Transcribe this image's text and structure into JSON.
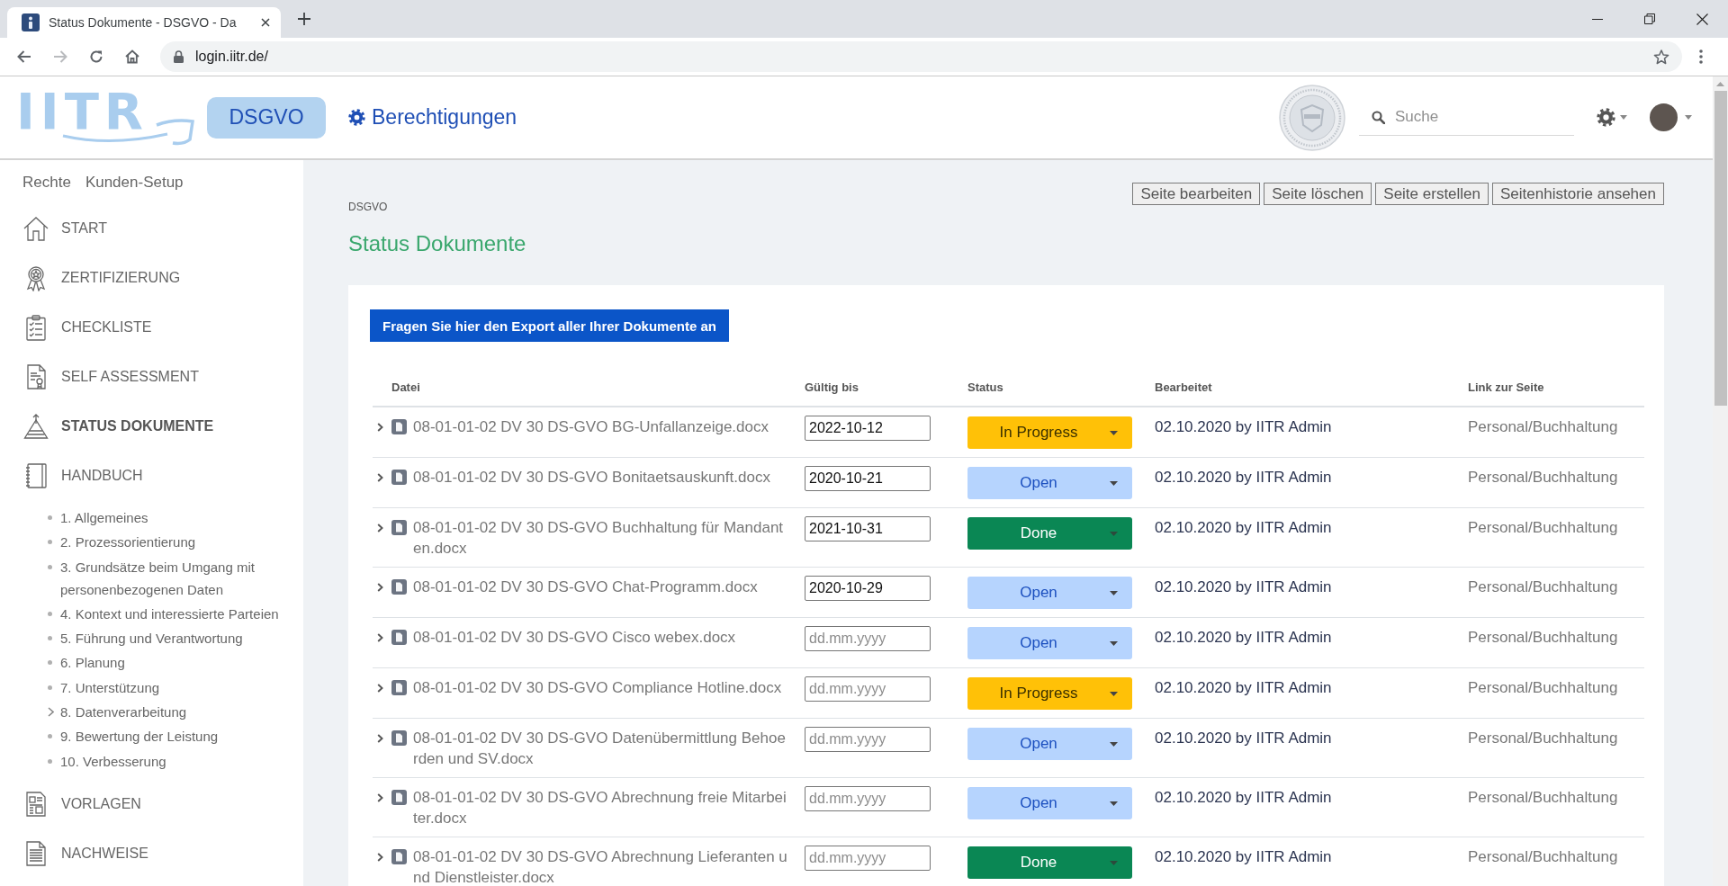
{
  "browser": {
    "tab": {
      "title": "Status Dokumente - DSGVO - Da"
    },
    "forward_disabled": true,
    "url": "login.iitr.de/"
  },
  "header": {
    "logo": "IITR",
    "module_button": "DSGVO",
    "permissions_link": "Berechtigungen",
    "search": {
      "placeholder": "Suche"
    }
  },
  "sidebar": {
    "top_links": [
      "Rechte",
      "Kunden-Setup"
    ],
    "items": [
      {
        "label": "START",
        "selected": false
      },
      {
        "label": "ZERTIFIZIERUNG",
        "selected": false
      },
      {
        "label": "CHECKLISTE",
        "selected": false
      },
      {
        "label": "SELF ASSESSMENT",
        "selected": false
      },
      {
        "label": "STATUS DOKUMENTE",
        "selected": true
      },
      {
        "label": "HANDBUCH",
        "selected": false,
        "children": [
          {
            "label": "1. Allgemeines",
            "expandable": false,
            "selected": false
          },
          {
            "label": "2. Prozessorientierung",
            "expandable": false,
            "selected": false
          },
          {
            "label": "3. Grundsätze beim Umgang mit personenbezogenen Daten",
            "expandable": false,
            "selected": false
          },
          {
            "label": "4. Kontext und interessierte Parteien",
            "expandable": false,
            "selected": false
          },
          {
            "label": "5. Führung und Verantwortung",
            "expandable": false,
            "selected": false
          },
          {
            "label": "6. Planung",
            "expandable": false,
            "selected": false
          },
          {
            "label": "7. Unterstützung",
            "expandable": false,
            "selected": false
          },
          {
            "label": "8. Datenverarbeitung",
            "expandable": true,
            "selected": false
          },
          {
            "label": "9. Bewertung der Leistung",
            "expandable": false,
            "selected": false
          },
          {
            "label": "10. Verbesserung",
            "expandable": false,
            "selected": false
          }
        ]
      },
      {
        "label": "VORLAGEN",
        "selected": false
      },
      {
        "label": "NACHWEISE",
        "selected": false
      }
    ]
  },
  "main": {
    "breadcrumb": "DSGVO",
    "page_actions": [
      "Seite bearbeiten",
      "Seite löschen",
      "Seite erstellen",
      "Seitenhistorie ansehen"
    ],
    "title": "Status Dokumente",
    "export_button": "Fragen Sie hier den Export aller Ihrer Dokumente an",
    "table": {
      "columns": [
        "Datei",
        "Gültig bis",
        "Status",
        "Bearbeitet",
        "Link zur Seite"
      ],
      "rows": [
        {
          "file": "08-01-01-02 DV 30 DS-GVO BG-Unfallanzeige.docx",
          "valid_until": {
            "value": "2022-10-12"
          },
          "status": {
            "label": "In Progress",
            "kind": "progress"
          },
          "edited": "02.10.2020 by IITR Admin",
          "link": "Personal/Buchhaltung"
        },
        {
          "file": "08-01-01-02 DV 30 DS-GVO Bonitaetsauskunft.docx",
          "valid_until": {
            "value": "2020-10-21"
          },
          "status": {
            "label": "Open",
            "kind": "open"
          },
          "edited": "02.10.2020 by IITR Admin",
          "link": "Personal/Buchhaltung"
        },
        {
          "file": "08-01-01-02 DV 30 DS-GVO Buchhaltung für Mandanten.docx",
          "valid_until": {
            "value": "2021-10-31"
          },
          "status": {
            "label": "Done",
            "kind": "done"
          },
          "edited": "02.10.2020 by IITR Admin",
          "link": "Personal/Buchhaltung"
        },
        {
          "file": "08-01-01-02 DV 30 DS-GVO Chat-Programm.docx",
          "valid_until": {
            "value": "2020-10-29"
          },
          "status": {
            "label": "Open",
            "kind": "open"
          },
          "edited": "02.10.2020 by IITR Admin",
          "link": "Personal/Buchhaltung"
        },
        {
          "file": "08-01-01-02 DV 30 DS-GVO Cisco webex.docx",
          "valid_until": {
            "placeholder": "dd.mm.yyyy"
          },
          "status": {
            "label": "Open",
            "kind": "open"
          },
          "edited": "02.10.2020 by IITR Admin",
          "link": "Personal/Buchhaltung"
        },
        {
          "file": "08-01-01-02 DV 30 DS-GVO Compliance Hotline.docx",
          "valid_until": {
            "placeholder": "dd.mm.yyyy"
          },
          "status": {
            "label": "In Progress",
            "kind": "progress"
          },
          "edited": "02.10.2020 by IITR Admin",
          "link": "Personal/Buchhaltung"
        },
        {
          "file": "08-01-01-02 DV 30 DS-GVO Datenübermittlung Behoerden und SV.docx",
          "valid_until": {
            "placeholder": "dd.mm.yyyy"
          },
          "status": {
            "label": "Open",
            "kind": "open"
          },
          "edited": "02.10.2020 by IITR Admin",
          "link": "Personal/Buchhaltung"
        },
        {
          "file": "08-01-01-02 DV 30 DS-GVO Abrechnung freie Mitarbeiter.docx",
          "valid_until": {
            "placeholder": "dd.mm.yyyy"
          },
          "status": {
            "label": "Open",
            "kind": "open"
          },
          "edited": "02.10.2020 by IITR Admin",
          "link": "Personal/Buchhaltung"
        },
        {
          "file": "08-01-01-02 DV 30 DS-GVO Abrechnung Lieferanten und Dienstleister.docx",
          "valid_until": {
            "placeholder": "dd.mm.yyyy"
          },
          "status": {
            "label": "Done",
            "kind": "done"
          },
          "edited": "02.10.2020 by IITR Admin",
          "link": "Personal/Buchhaltung"
        }
      ]
    }
  }
}
